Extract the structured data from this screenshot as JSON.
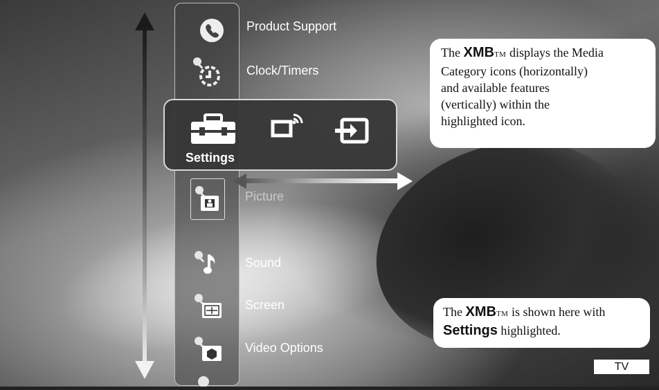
{
  "xmb": {
    "above_items": [
      {
        "label": "Product Support",
        "icon": "phone-icon"
      },
      {
        "label": "Clock/Timers",
        "icon": "clock-timer-icon"
      }
    ],
    "category_bar": {
      "highlighted_label": "Settings",
      "categories": [
        {
          "name": "settings",
          "icon": "toolbox-icon"
        },
        {
          "name": "tv",
          "icon": "tv-broadcast-icon"
        },
        {
          "name": "input",
          "icon": "external-input-icon"
        }
      ]
    },
    "below_items": [
      {
        "label": "Picture",
        "icon": "picture-icon",
        "selected": true
      },
      {
        "label": "Sound",
        "icon": "sound-icon"
      },
      {
        "label": "Screen",
        "icon": "screen-icon"
      },
      {
        "label": "Video Options",
        "icon": "video-options-icon"
      }
    ]
  },
  "callout_top": {
    "line1_pre": "The ",
    "brand": "XMB",
    "tm": "TM",
    "line1_post": " displays the Media",
    "line2": "Category icons (horizontally)",
    "line3": "and available features",
    "line4": "(vertically) within the",
    "line5": "highlighted icon."
  },
  "callout_bottom": {
    "line1_pre": "The ",
    "brand": "XMB",
    "tm": "TM",
    "line1_post": " is shown here with",
    "emph": "Settings",
    "line2_post": " highlighted."
  },
  "badge": "TV",
  "colors": {
    "callout_bg": "#ffffff",
    "bar_border": "#d8d8d8",
    "text": "#ffffff"
  }
}
